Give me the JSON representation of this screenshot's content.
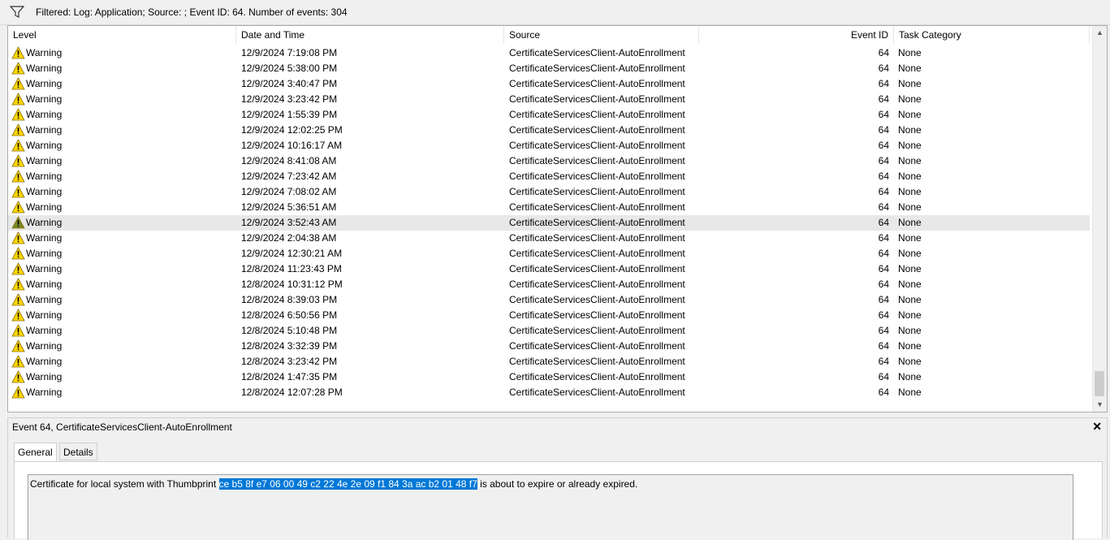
{
  "filter": {
    "icon": "filter-icon",
    "text": "Filtered: Log: Application; Source: ; Event ID: 64. Number of events: 304"
  },
  "grid": {
    "columns": [
      "Level",
      "Date and Time",
      "Source",
      "Event ID",
      "Task Category"
    ],
    "rows": [
      {
        "level": "Warning",
        "date": "12/9/2024 7:19:08 PM",
        "source": "CertificateServicesClient-AutoEnrollment",
        "id": "64",
        "category": "None"
      },
      {
        "level": "Warning",
        "date": "12/9/2024 5:38:00 PM",
        "source": "CertificateServicesClient-AutoEnrollment",
        "id": "64",
        "category": "None"
      },
      {
        "level": "Warning",
        "date": "12/9/2024 3:40:47 PM",
        "source": "CertificateServicesClient-AutoEnrollment",
        "id": "64",
        "category": "None"
      },
      {
        "level": "Warning",
        "date": "12/9/2024 3:23:42 PM",
        "source": "CertificateServicesClient-AutoEnrollment",
        "id": "64",
        "category": "None"
      },
      {
        "level": "Warning",
        "date": "12/9/2024 1:55:39 PM",
        "source": "CertificateServicesClient-AutoEnrollment",
        "id": "64",
        "category": "None"
      },
      {
        "level": "Warning",
        "date": "12/9/2024 12:02:25 PM",
        "source": "CertificateServicesClient-AutoEnrollment",
        "id": "64",
        "category": "None"
      },
      {
        "level": "Warning",
        "date": "12/9/2024 10:16:17 AM",
        "source": "CertificateServicesClient-AutoEnrollment",
        "id": "64",
        "category": "None"
      },
      {
        "level": "Warning",
        "date": "12/9/2024 8:41:08 AM",
        "source": "CertificateServicesClient-AutoEnrollment",
        "id": "64",
        "category": "None"
      },
      {
        "level": "Warning",
        "date": "12/9/2024 7:23:42 AM",
        "source": "CertificateServicesClient-AutoEnrollment",
        "id": "64",
        "category": "None"
      },
      {
        "level": "Warning",
        "date": "12/9/2024 7:08:02 AM",
        "source": "CertificateServicesClient-AutoEnrollment",
        "id": "64",
        "category": "None"
      },
      {
        "level": "Warning",
        "date": "12/9/2024 5:36:51 AM",
        "source": "CertificateServicesClient-AutoEnrollment",
        "id": "64",
        "category": "None"
      },
      {
        "level": "Warning",
        "date": "12/9/2024 3:52:43 AM",
        "source": "CertificateServicesClient-AutoEnrollment",
        "id": "64",
        "category": "None",
        "highlighted": true
      },
      {
        "level": "Warning",
        "date": "12/9/2024 2:04:38 AM",
        "source": "CertificateServicesClient-AutoEnrollment",
        "id": "64",
        "category": "None"
      },
      {
        "level": "Warning",
        "date": "12/9/2024 12:30:21 AM",
        "source": "CertificateServicesClient-AutoEnrollment",
        "id": "64",
        "category": "None"
      },
      {
        "level": "Warning",
        "date": "12/8/2024 11:23:43 PM",
        "source": "CertificateServicesClient-AutoEnrollment",
        "id": "64",
        "category": "None"
      },
      {
        "level": "Warning",
        "date": "12/8/2024 10:31:12 PM",
        "source": "CertificateServicesClient-AutoEnrollment",
        "id": "64",
        "category": "None"
      },
      {
        "level": "Warning",
        "date": "12/8/2024 8:39:03 PM",
        "source": "CertificateServicesClient-AutoEnrollment",
        "id": "64",
        "category": "None"
      },
      {
        "level": "Warning",
        "date": "12/8/2024 6:50:56 PM",
        "source": "CertificateServicesClient-AutoEnrollment",
        "id": "64",
        "category": "None"
      },
      {
        "level": "Warning",
        "date": "12/8/2024 5:10:48 PM",
        "source": "CertificateServicesClient-AutoEnrollment",
        "id": "64",
        "category": "None"
      },
      {
        "level": "Warning",
        "date": "12/8/2024 3:32:39 PM",
        "source": "CertificateServicesClient-AutoEnrollment",
        "id": "64",
        "category": "None"
      },
      {
        "level": "Warning",
        "date": "12/8/2024 3:23:42 PM",
        "source": "CertificateServicesClient-AutoEnrollment",
        "id": "64",
        "category": "None"
      },
      {
        "level": "Warning",
        "date": "12/8/2024 1:47:35 PM",
        "source": "CertificateServicesClient-AutoEnrollment",
        "id": "64",
        "category": "None"
      },
      {
        "level": "Warning",
        "date": "12/8/2024 12:07:28 PM",
        "source": "CertificateServicesClient-AutoEnrollment",
        "id": "64",
        "category": "None"
      }
    ]
  },
  "detail": {
    "title": "Event 64, CertificateServicesClient-AutoEnrollment",
    "close_label": "✕",
    "tabs": [
      "General",
      "Details"
    ],
    "message_before": "Certificate for local system with Thumbprint ",
    "message_selected": "ce b5 8f e7 06 00 49 c2 22 4e 2e 09 f1 84 3a ac b2 01 48 f7",
    "message_after": " is about to expire or already expired."
  },
  "colors": {
    "selection": "#0078d7",
    "warning_fill": "#ffd800",
    "highlight_row": "#e8e8e8"
  }
}
